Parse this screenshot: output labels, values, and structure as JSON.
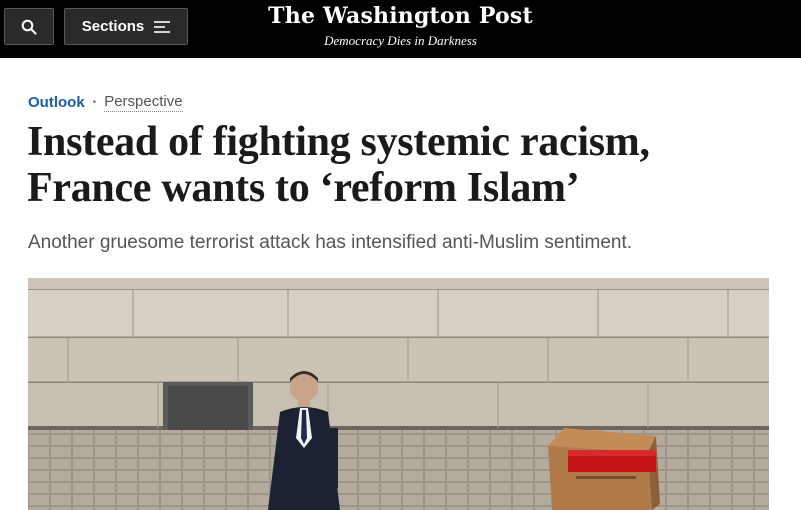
{
  "header": {
    "search_icon": "search-icon",
    "sections_label": "Sections",
    "sections_icon": "menu-icon",
    "brand_name": "The Washington Post",
    "brand_tagline": "Democracy Dies in Darkness"
  },
  "article": {
    "section": "Outlook",
    "separator": "•",
    "label": "Perspective",
    "headline_line1": "Instead of fighting systemic racism,",
    "headline_line2": "France wants to ‘reform Islam’",
    "subhead": "Another gruesome terrorist attack has intensified anti-Muslim sentiment."
  },
  "colors": {
    "topbar": "#000000",
    "section_link": "#1a5ca8",
    "headline": "#1a1a1a",
    "subhead": "#555555"
  }
}
